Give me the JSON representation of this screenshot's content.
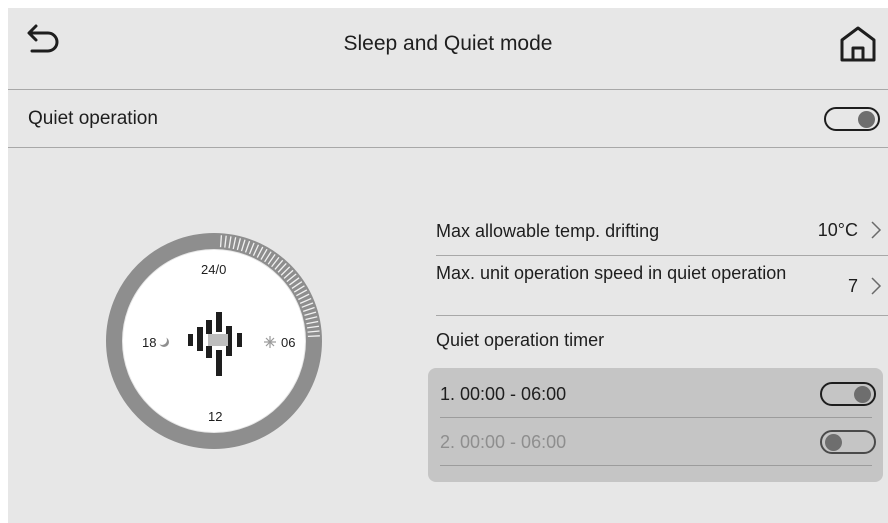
{
  "header": {
    "title": "Sleep and Quiet mode",
    "back_icon": "back-arrow-icon",
    "home_icon": "home-icon"
  },
  "quiet_operation": {
    "label": "Quiet operation",
    "enabled": true
  },
  "settings": [
    {
      "label": "Max allowable temp. drifting",
      "value": "10°C"
    },
    {
      "label": "Max. unit operation speed in quiet operation",
      "value": "7"
    }
  ],
  "timer": {
    "label": "Quiet operation timer",
    "items": [
      {
        "text": "1. 00:00 - 06:00",
        "enabled": true
      },
      {
        "text": "2. 00:00 - 06:00",
        "enabled": false
      }
    ]
  },
  "clock": {
    "top_label": "24/0",
    "left_label": "18",
    "right_label": "06",
    "bottom_label": "12",
    "night_icon": "moon-icon",
    "day_icon": "sun-icon"
  },
  "colors": {
    "background": "#e7e7e7",
    "panel": "#c5c5c5",
    "ring": "#8e8e8e",
    "text": "#1e1e1e",
    "disabled_text": "#8e8e8e"
  }
}
